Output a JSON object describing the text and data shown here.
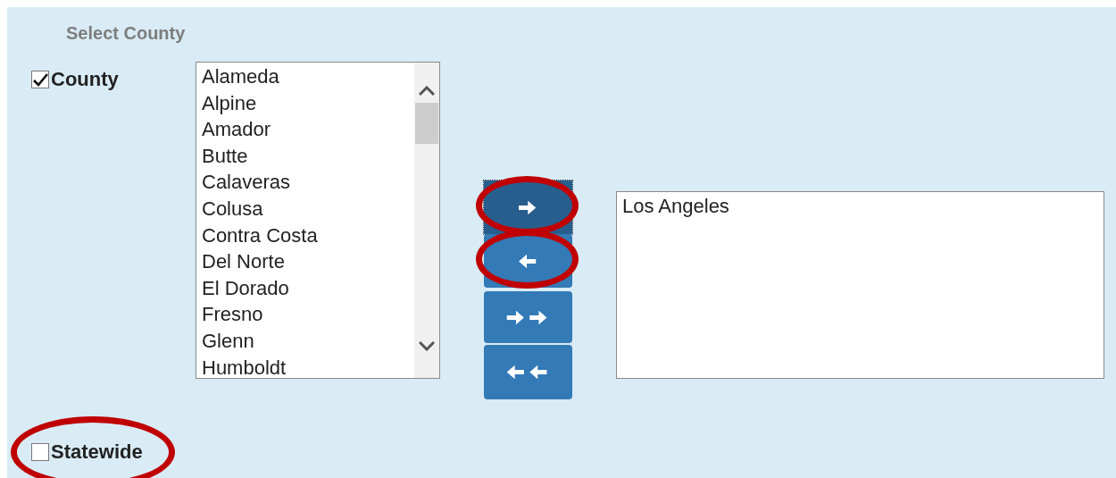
{
  "title": "Select County",
  "county_option": {
    "label": "County",
    "checked": true
  },
  "available_counties": [
    "Alameda",
    "Alpine",
    "Amador",
    "Butte",
    "Calaveras",
    "Colusa",
    "Contra Costa",
    "Del Norte",
    "El Dorado",
    "Fresno",
    "Glenn",
    "Humboldt"
  ],
  "transfer_buttons": [
    {
      "kind": "add",
      "focused": true,
      "circled": true
    },
    {
      "kind": "remove",
      "focused": false,
      "circled": true
    },
    {
      "kind": "add_all",
      "focused": false,
      "circled": false
    },
    {
      "kind": "remove_all",
      "focused": false,
      "circled": false
    }
  ],
  "selected_counties": [
    "Los Angeles"
  ],
  "statewide_option": {
    "label": "Statewide",
    "checked": false,
    "circled": true
  }
}
